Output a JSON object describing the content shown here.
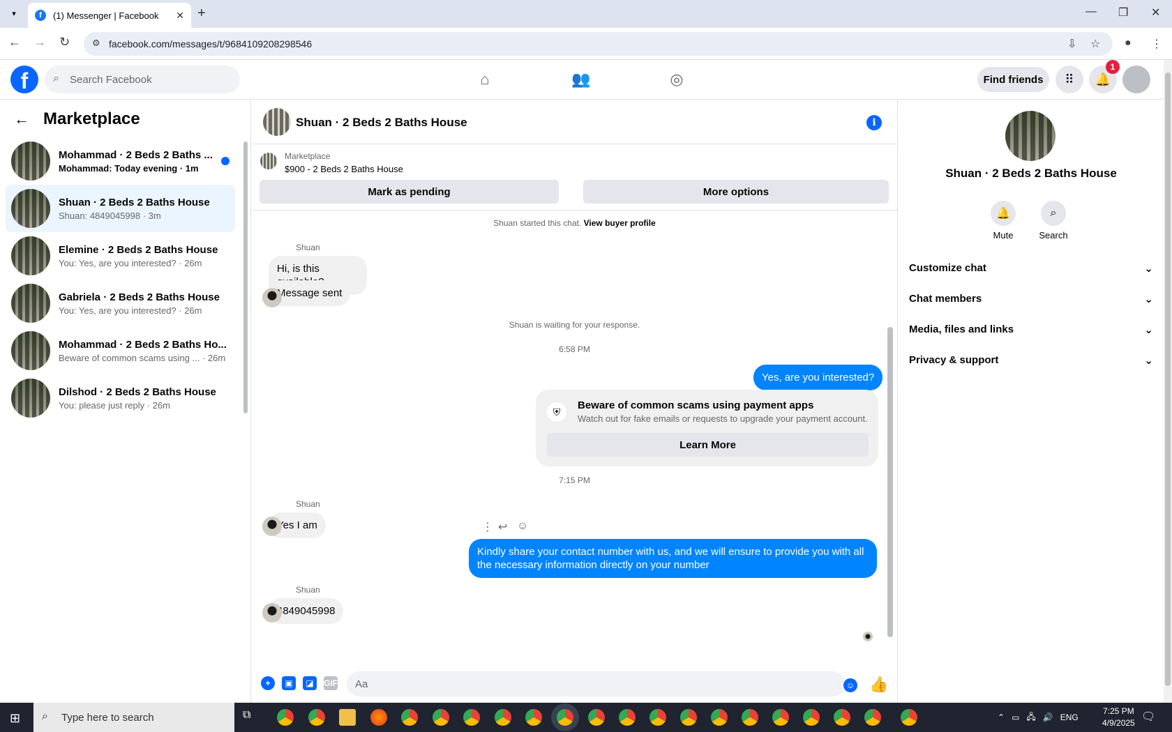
{
  "browser": {
    "tab_title": "(1) Messenger | Facebook",
    "url": "facebook.com/messages/t/9684109208298546"
  },
  "fb": {
    "search_placeholder": "Search Facebook",
    "find_friends": "Find friends",
    "notification_count": "1"
  },
  "left": {
    "title": "Marketplace",
    "conversations": [
      {
        "name": "Mohammad · 2 Beds 2 Baths ...",
        "sub": "Mohammad: Today evening · 1m",
        "unread": true
      },
      {
        "name": "Shuan · 2 Beds 2 Baths House",
        "sub": "Shuan: 4849045998 · 3m",
        "unread": false
      },
      {
        "name": "Elemine · 2 Beds 2 Baths House",
        "sub": "You: Yes, are you interested? · 26m",
        "unread": false
      },
      {
        "name": "Gabriela · 2 Beds 2 Baths House",
        "sub": "You: Yes, are you interested? · 26m",
        "unread": false
      },
      {
        "name": "Mohammad · 2 Beds 2 Baths Ho...",
        "sub": "Beware of common scams using ... · 26m",
        "unread": false
      },
      {
        "name": "Dilshod · 2 Beds 2 Baths House",
        "sub": "You: please just reply · 26m",
        "unread": false
      }
    ]
  },
  "chat": {
    "title": "Shuan · 2 Beds 2 Baths House",
    "marketplace_label": "Marketplace",
    "listing": "$900 - 2 Beds 2 Baths House",
    "mark_pending": "Mark as pending",
    "more_options": "More options",
    "started": "Shuan started this chat.",
    "view_profile": "View buyer profile",
    "sender": "Shuan",
    "m1": "Hi, is this available?",
    "m2": "Message sent",
    "waiting": "Shuan is waiting for your response.",
    "time1": "6:58 PM",
    "out1": "Yes, are you interested?",
    "scam_title": "Beware of common scams using payment apps",
    "scam_text": "Watch out for fake emails or requests to upgrade your payment account.",
    "learn_more": "Learn More",
    "time2": "7:15 PM",
    "m3": "Yes I am",
    "out2": "Kindly share your contact number with us, and we will ensure to provide you with all the necessary information directly on your number",
    "m4": "4849045998",
    "input_placeholder": "Aa",
    "gif_label": "GIF"
  },
  "right": {
    "name": "Shuan · 2 Beds 2 Baths House",
    "mute": "Mute",
    "search": "Search",
    "sections": [
      "Customize chat",
      "Chat members",
      "Media, files and links",
      "Privacy & support"
    ]
  },
  "taskbar": {
    "search_placeholder": "Type here to search",
    "lang": "ENG",
    "time": "7:25 PM",
    "date": "4/9/2025"
  }
}
